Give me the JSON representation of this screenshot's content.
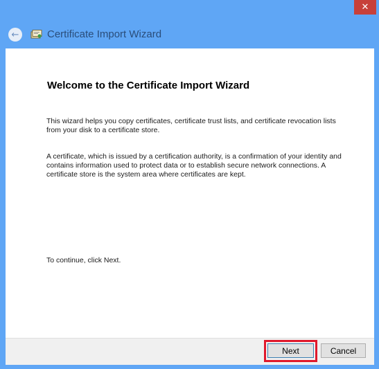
{
  "window": {
    "close_glyph": "✕",
    "accent_color": "#5fa6f5"
  },
  "header": {
    "title": "Certificate Import Wizard",
    "back_icon": "back-arrow-icon",
    "app_icon": "certificate-icon"
  },
  "main": {
    "heading": "Welcome to the Certificate Import Wizard",
    "paragraph_1": "This wizard helps you copy certificates, certificate trust lists, and certificate revocation lists from your disk to a certificate store.",
    "paragraph_2": "A certificate, which is issued by a certification authority, is a confirmation of your identity and contains information used to protect data or to establish secure network connections. A certificate store is the system area where certificates are kept.",
    "paragraph_3": "To continue, click Next."
  },
  "footer": {
    "next_label": "Next",
    "cancel_label": "Cancel",
    "highlight_color": "#e0182c"
  }
}
